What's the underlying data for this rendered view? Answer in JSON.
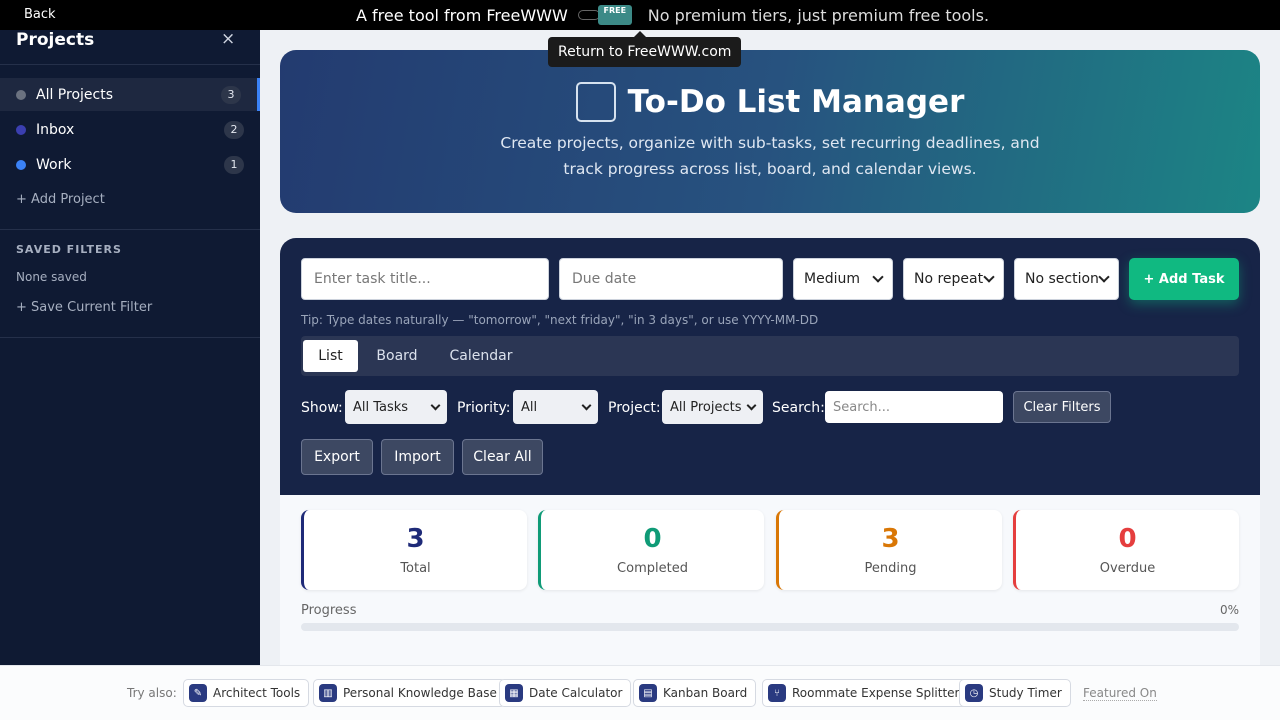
{
  "topbar": {
    "back_label": "Back",
    "lead_text": "A free tool from FreeWWW",
    "logo_text": "FREE",
    "tagline": "No premium tiers, just premium free tools.",
    "tooltip": "Return to FreeWWW.com"
  },
  "sidebar": {
    "title": "Projects",
    "close_icon": "×",
    "projects": [
      {
        "label": "All Projects",
        "count": "3",
        "color": "#6b7280",
        "active": true
      },
      {
        "label": "Inbox",
        "count": "2",
        "color": "#3b3fb0",
        "active": false
      },
      {
        "label": "Work",
        "count": "1",
        "color": "#3b82f6",
        "active": false
      }
    ],
    "add_project": "+ Add Project",
    "saved_filters_heading": "SAVED FILTERS",
    "none_saved": "None saved",
    "save_filter": "+ Save Current Filter"
  },
  "hero": {
    "title": "To-Do List Manager",
    "subtitle": "Create projects, organize with sub-tasks, set recurring deadlines, and track progress across list, board, and calendar views."
  },
  "task_form": {
    "title_placeholder": "Enter task title...",
    "due_placeholder": "Due date",
    "priority_value": "Medium",
    "repeat_value": "No repeat",
    "section_value": "No section",
    "add_button": "+ Add Task",
    "tip": "Tip: Type dates naturally — \"tomorrow\", \"next friday\", \"in 3 days\", or use YYYY-MM-DD"
  },
  "view_tabs": [
    {
      "label": "List",
      "active": true
    },
    {
      "label": "Board",
      "active": false
    },
    {
      "label": "Calendar",
      "active": false
    }
  ],
  "filters": {
    "show_label": "Show:",
    "show_value": "All Tasks",
    "priority_label": "Priority:",
    "priority_value": "All",
    "project_label": "Project:",
    "project_value": "All Projects",
    "search_label": "Search:",
    "search_placeholder": "Search...",
    "clear_filters": "Clear Filters"
  },
  "actions": {
    "export": "Export",
    "import": "Import",
    "clear_all": "Clear All"
  },
  "stats": [
    {
      "value": "3",
      "label": "Total",
      "color": "#1e2a78"
    },
    {
      "value": "0",
      "label": "Completed",
      "color": "#0f9b77"
    },
    {
      "value": "3",
      "label": "Pending",
      "color": "#d97706"
    },
    {
      "value": "0",
      "label": "Overdue",
      "color": "#e53e3e"
    }
  ],
  "progress": {
    "label": "Progress",
    "percent_text": "0%",
    "value": 0
  },
  "footer": {
    "try_label": "Try also:",
    "tools": [
      {
        "label": "Architect Tools",
        "icon": "compass-icon"
      },
      {
        "label": "Personal Knowledge Base",
        "icon": "books-icon"
      },
      {
        "label": "Date Calculator",
        "icon": "calendar-icon"
      },
      {
        "label": "Kanban Board",
        "icon": "kanban-icon"
      },
      {
        "label": "Roommate Expense Splitter",
        "icon": "split-icon"
      },
      {
        "label": "Study Timer",
        "icon": "stopwatch-icon"
      }
    ],
    "featured": "Featured On"
  }
}
